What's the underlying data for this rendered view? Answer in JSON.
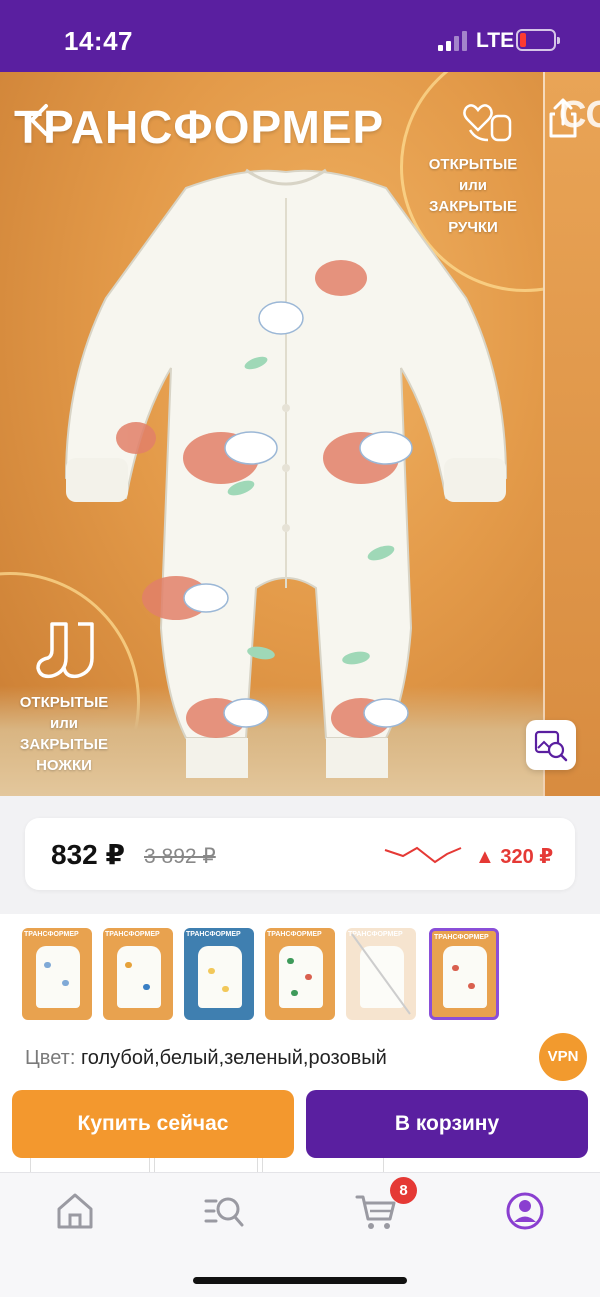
{
  "status_bar": {
    "time": "14:47",
    "network": "LTE",
    "battery_color": "#ff3b30"
  },
  "hero": {
    "title": "ТРАНСФОРМЕР",
    "next_title_fragment": "СО",
    "caption_hands": [
      "ОТКРЫТЫЕ",
      "или",
      "ЗАКРЫТЫЕ",
      "РУЧКИ"
    ],
    "caption_legs": [
      "ОТКРЫТЫЕ",
      "или",
      "ЗАКРЫТЫЕ",
      "НОЖКИ"
    ],
    "icons": {
      "back": "chevron-left-icon",
      "share": "share-icon",
      "hands": "hearts-hands-icon",
      "socks": "socks-icon",
      "image_search": "image-search-icon"
    }
  },
  "price": {
    "current": "832 ₽",
    "old": "3 892 ₽",
    "change": "▲ 320 ₽",
    "change_color": "#e53935"
  },
  "thumbnails": [
    {
      "title": "ТРАНСФОРМЕР",
      "bg": "#e8a24f",
      "pattern": "#7fa9d6",
      "selected": false
    },
    {
      "title": "ТРАНСФОРМЕР",
      "bg": "#e8a24f",
      "pattern": "#e6a23a",
      "selected": false
    },
    {
      "title": "ТРАНСФОРМЕР",
      "bg": "#3f7fb0",
      "pattern": "#f2c85a",
      "selected": false
    },
    {
      "title": "ТРАНСФОРМЕР",
      "bg": "#e8a24f",
      "pattern": "#3e9a5a",
      "selected": false
    },
    {
      "title": "ТРАНСФОРМЕР",
      "bg": "#f3dcc0",
      "pattern": "#d8d8d8",
      "selected": false
    },
    {
      "title": "ТРАНСФОРМЕР",
      "bg": "#e8a24f",
      "pattern": "#d9604f",
      "selected": true
    }
  ],
  "color": {
    "label": "Цвет:",
    "value": "голубой,белый,зеленый,розовый"
  },
  "vpn_badge": "VPN",
  "actions": {
    "buy_now": "Купить сейчас",
    "add_to_cart": "В корзину",
    "buy_color": "#f3982e",
    "cart_color": "#5a1fa0"
  },
  "tabbar": {
    "items": [
      "home-icon",
      "catalog-search-icon",
      "cart-icon",
      "profile-icon"
    ],
    "cart_count": "8",
    "active_color": "#8a3fd0"
  }
}
